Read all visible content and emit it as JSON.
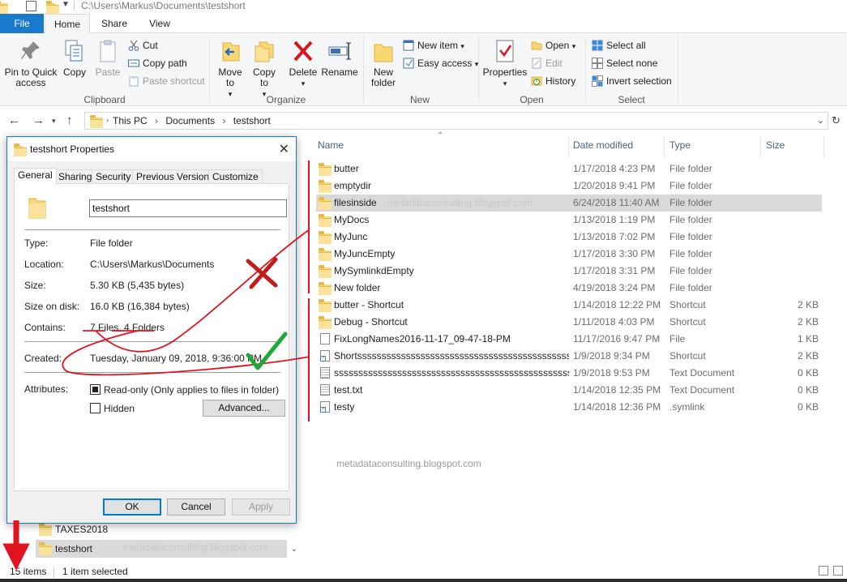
{
  "window": {
    "title_path": "C:\\Users\\Markus\\Documents\\testshort"
  },
  "tabs": [
    {
      "label": "File"
    },
    {
      "label": "Home"
    },
    {
      "label": "Share"
    },
    {
      "label": "View"
    }
  ],
  "ribbon": {
    "clipboard": {
      "label": "Clipboard",
      "pin": "Pin to Quick access",
      "copy": "Copy",
      "paste": "Paste",
      "cut": "Cut",
      "copy_path": "Copy path",
      "paste_shortcut": "Paste shortcut"
    },
    "organize": {
      "label": "Organize",
      "move_to": "Move to",
      "copy_to": "Copy to",
      "delete": "Delete",
      "rename": "Rename"
    },
    "new": {
      "label": "New",
      "new_folder": "New folder",
      "new_item": "New item",
      "easy_access": "Easy access"
    },
    "open": {
      "label": "Open",
      "properties": "Properties",
      "open": "Open",
      "edit": "Edit",
      "history": "History"
    },
    "select": {
      "label": "Select",
      "select_all": "Select all",
      "select_none": "Select none",
      "invert_selection": "Invert selection"
    }
  },
  "address": {
    "crumbs": [
      "This PC",
      "Documents",
      "testshort"
    ]
  },
  "columns": {
    "name": "Name",
    "date_modified": "Date modified",
    "type": "Type",
    "size": "Size"
  },
  "files": [
    {
      "name": "butter",
      "date": "1/17/2018 4:23 PM",
      "type": "File folder",
      "size": "",
      "icon": "folder-icon"
    },
    {
      "name": "emptydir",
      "date": "1/20/2018 9:41 PM",
      "type": "File folder",
      "size": "",
      "icon": "folder-icon"
    },
    {
      "name": "filesinside",
      "date": "6/24/2018 11:40 AM",
      "type": "File folder",
      "size": "",
      "icon": "folder-icon",
      "selected": true
    },
    {
      "name": "MyDocs",
      "date": "1/13/2018 1:19 PM",
      "type": "File folder",
      "size": "",
      "icon": "folder-link-icon"
    },
    {
      "name": "MyJunc",
      "date": "1/13/2018 7:02 PM",
      "type": "File folder",
      "size": "",
      "icon": "folder-link-icon"
    },
    {
      "name": "MyJuncEmpty",
      "date": "1/17/2018 3:30 PM",
      "type": "File folder",
      "size": "",
      "icon": "folder-link-icon"
    },
    {
      "name": "MySymlinkdEmpty",
      "date": "1/17/2018 3:31 PM",
      "type": "File folder",
      "size": "",
      "icon": "folder-link-icon"
    },
    {
      "name": "New folder",
      "date": "4/19/2018 3:24 PM",
      "type": "File folder",
      "size": "",
      "icon": "folder-icon"
    },
    {
      "name": "butter - Shortcut",
      "date": "1/14/2018 12:22 PM",
      "type": "Shortcut",
      "size": "2 KB",
      "icon": "folder-link-icon"
    },
    {
      "name": "Debug - Shortcut",
      "date": "1/11/2018 4:03 PM",
      "type": "Shortcut",
      "size": "2 KB",
      "icon": "folder-link-icon"
    },
    {
      "name": "FixLongNames2016-11-17_09-47-18-PM",
      "date": "11/17/2016 9:47 PM",
      "type": "File",
      "size": "1 KB",
      "icon": "file-icon"
    },
    {
      "name": "Shortsssssssssssssssssssssssssssssssssssssssssssssssssssssss...",
      "date": "1/9/2018 9:34 PM",
      "type": "Shortcut",
      "size": "2 KB",
      "icon": "file-link-icon"
    },
    {
      "name": "sssssssssssssssssssssssssssssssssssssssssssssssssssssssssssssss...",
      "date": "1/9/2018 9:53 PM",
      "type": "Text Document",
      "size": "0 KB",
      "icon": "text-file-icon"
    },
    {
      "name": "test.txt",
      "date": "1/14/2018 12:35 PM",
      "type": "Text Document",
      "size": "0 KB",
      "icon": "text-file-icon"
    },
    {
      "name": "testy",
      "date": "1/14/2018 12:36 PM",
      "type": ".symlink",
      "size": "0 KB",
      "icon": "file-link-icon"
    }
  ],
  "nav": [
    {
      "label": "TAXES2018"
    },
    {
      "label": "testshort",
      "selected": true
    }
  ],
  "status": {
    "items": "15 items",
    "selected": "1 item selected"
  },
  "watermark": "metadataconsulting.blogspot.com",
  "dialog": {
    "title": "testshort Properties",
    "tabs": [
      "General",
      "Sharing",
      "Security",
      "Previous Versions",
      "Customize"
    ],
    "name_value": "testshort",
    "type_label": "Type:",
    "type_value": "File folder",
    "location_label": "Location:",
    "location_value": "C:\\Users\\Markus\\Documents",
    "size_label": "Size:",
    "size_value": "5.30 KB (5,435 bytes)",
    "size_on_disk_label": "Size on disk:",
    "size_on_disk_value": "16.0 KB (16,384 bytes)",
    "contains_label": "Contains:",
    "contains_files": "7 Files",
    "contains_folders": "4 Folders",
    "created_label": "Created:",
    "created_value": "Tuesday, January 09, 2018, 9:36:00 PM",
    "attributes_label": "Attributes:",
    "readonly_label": "Read-only (Only applies to files in folder)",
    "hidden_label": "Hidden",
    "advanced_label": "Advanced...",
    "ok_label": "OK",
    "cancel_label": "Cancel",
    "apply_label": "Apply"
  },
  "colors": {
    "accent": "#1979ca",
    "annotation_red": "#e0141e",
    "annotation_green": "#1fa83a",
    "selection": "#d9d9d9"
  }
}
